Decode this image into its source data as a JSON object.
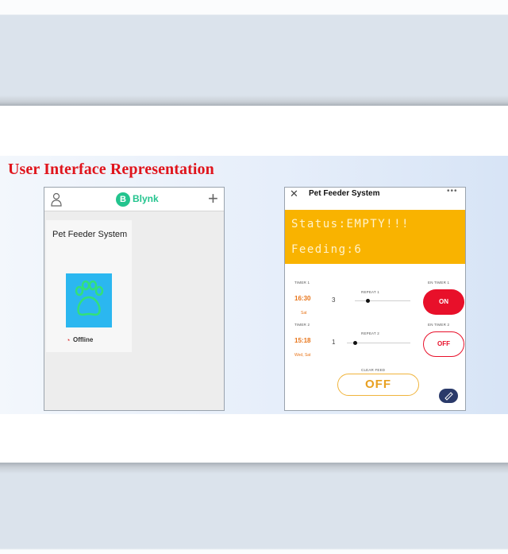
{
  "slide": {
    "title": "User Interface Representation"
  },
  "blynk_home": {
    "brand_logo_letter": "B",
    "brand_name": "Blynk",
    "project_name": "Pet Feeder System",
    "project_icon": "paw-icon",
    "project_tile_color": "#2bb7f0",
    "device_status": "Offline"
  },
  "feeder_app": {
    "title": "Pet Feeder System",
    "more": "•••",
    "status_text": "Status:EMPTY!!!",
    "feeding_text": "Feeding:6",
    "banner_color": "#f9b300",
    "timer1": {
      "label": "TIMER 1",
      "time": "16:30",
      "sub": "Sat",
      "repeat_label": "REPEAT 1",
      "repeat_value": "3",
      "en_label": "EN TIMER 1",
      "en_state": "ON"
    },
    "timer2": {
      "label": "TIMER 2",
      "time": "15:18",
      "sub": "Wed, Sat",
      "repeat_label": "REPEAT 2",
      "repeat_value": "1",
      "en_label": "EN TIMER 2",
      "en_state": "OFF"
    },
    "clear_feed": {
      "label": "CLEAR FEED",
      "state": "OFF"
    },
    "accent_red": "#e8102a"
  }
}
